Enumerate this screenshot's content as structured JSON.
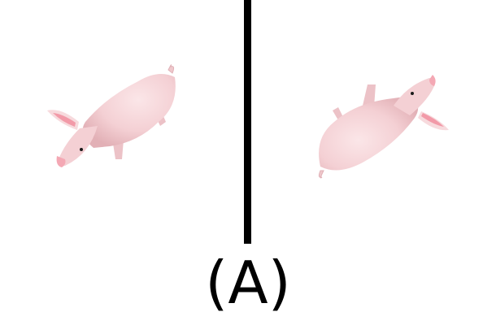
{
  "caption": {
    "label": "(A)"
  },
  "panels": [
    {
      "subject": "pig-icon",
      "orientation": "standing"
    },
    {
      "subject": "pig-icon",
      "orientation": "upside-down"
    }
  ],
  "colors": {
    "background": "#ffffff",
    "divider": "#000000",
    "pig_body": "#f6d3d6",
    "pig_shadow": "#e6b4ba",
    "pig_ear_inner": "#f29aa8",
    "pig_snout": "#f4a8b4",
    "pig_eye": "#1a1a1a"
  }
}
